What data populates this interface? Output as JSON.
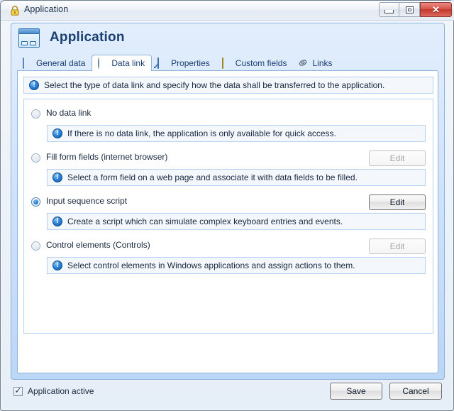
{
  "window": {
    "title": "Application",
    "lock_icon": "lock-icon",
    "buttons": {
      "minimize": "minimize-icon",
      "maximize": "maximize-icon",
      "close": "✕"
    }
  },
  "header": {
    "icon": "application-window-icon",
    "title": "Application"
  },
  "tabs": [
    {
      "label": "General data",
      "icon": "document-icon",
      "active": false
    },
    {
      "label": "Data link",
      "icon": "gear-icon",
      "active": true
    },
    {
      "label": "Properties",
      "icon": "properties-icon",
      "active": false
    },
    {
      "label": "Custom fields",
      "icon": "list-icon",
      "active": false
    },
    {
      "label": "Links",
      "icon": "paperclip-icon",
      "active": false
    }
  ],
  "top_info": {
    "icon": "info-icon",
    "text": "Select the type of data link and specify how the data shall be transferred to the application."
  },
  "options": [
    {
      "label": "No data link",
      "selected": false,
      "has_edit": false,
      "edit_label": "Edit",
      "edit_enabled": false,
      "info": "If there is no data link, the application is only available for quick access."
    },
    {
      "label": "Fill form fields (internet browser)",
      "selected": false,
      "has_edit": true,
      "edit_label": "Edit",
      "edit_enabled": false,
      "info": "Select a form field on a web page and associate it with data fields to be filled."
    },
    {
      "label": "Input sequence script",
      "selected": true,
      "has_edit": true,
      "edit_label": "Edit",
      "edit_enabled": true,
      "info": "Create a script which can simulate complex keyboard entries and events."
    },
    {
      "label": "Control elements (Controls)",
      "selected": false,
      "has_edit": true,
      "edit_label": "Edit",
      "edit_enabled": false,
      "info": "Select control elements in Windows applications and assign actions to them."
    }
  ],
  "footer": {
    "active_checkbox_label": "Application active",
    "active_checked": true,
    "save_label": "Save",
    "cancel_label": "Cancel"
  },
  "colors": {
    "accent": "#1b3f73",
    "panel_border": "#8fb2d9",
    "info_bg": "#f4f8fd",
    "info_border": "#b9d2ee",
    "close_red": "#c5362c"
  }
}
